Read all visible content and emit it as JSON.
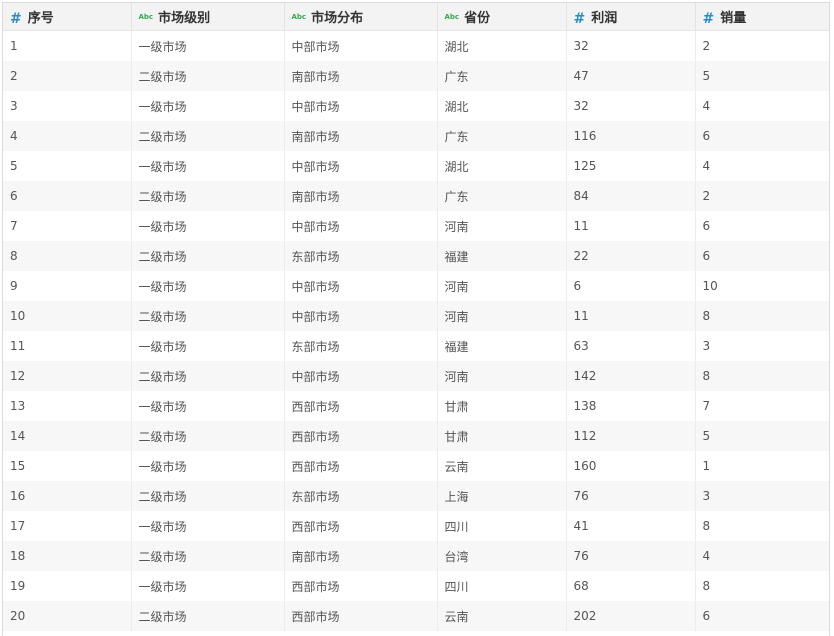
{
  "columns": [
    {
      "label": "序号",
      "type_icon": "#",
      "icon_name": "numeric-type-icon"
    },
    {
      "label": "市场级别",
      "type_icon": "Abc",
      "icon_name": "text-type-icon"
    },
    {
      "label": "市场分布",
      "type_icon": "Abc",
      "icon_name": "text-type-icon"
    },
    {
      "label": "省份",
      "type_icon": "Abc",
      "icon_name": "text-type-icon"
    },
    {
      "label": "利润",
      "type_icon": "#",
      "icon_name": "numeric-type-icon"
    },
    {
      "label": "销量",
      "type_icon": "#",
      "icon_name": "numeric-type-icon"
    }
  ],
  "rows": [
    [
      "1",
      "一级市场",
      "中部市场",
      "湖北",
      "32",
      "2"
    ],
    [
      "2",
      "二级市场",
      "南部市场",
      "广东",
      "47",
      "5"
    ],
    [
      "3",
      "一级市场",
      "中部市场",
      "湖北",
      "32",
      "4"
    ],
    [
      "4",
      "二级市场",
      "南部市场",
      "广东",
      "116",
      "6"
    ],
    [
      "5",
      "一级市场",
      "中部市场",
      "湖北",
      "125",
      "4"
    ],
    [
      "6",
      "二级市场",
      "南部市场",
      "广东",
      "84",
      "2"
    ],
    [
      "7",
      "一级市场",
      "中部市场",
      "河南",
      "11",
      "6"
    ],
    [
      "8",
      "二级市场",
      "东部市场",
      "福建",
      "22",
      "6"
    ],
    [
      "9",
      "一级市场",
      "中部市场",
      "河南",
      "6",
      "10"
    ],
    [
      "10",
      "二级市场",
      "中部市场",
      "河南",
      "11",
      "8"
    ],
    [
      "11",
      "一级市场",
      "东部市场",
      "福建",
      "63",
      "3"
    ],
    [
      "12",
      "二级市场",
      "中部市场",
      "河南",
      "142",
      "8"
    ],
    [
      "13",
      "一级市场",
      "西部市场",
      "甘肃",
      "138",
      "7"
    ],
    [
      "14",
      "二级市场",
      "西部市场",
      "甘肃",
      "112",
      "5"
    ],
    [
      "15",
      "一级市场",
      "西部市场",
      "云南",
      "160",
      "1"
    ],
    [
      "16",
      "二级市场",
      "东部市场",
      "上海",
      "76",
      "3"
    ],
    [
      "17",
      "一级市场",
      "西部市场",
      "四川",
      "41",
      "8"
    ],
    [
      "18",
      "二级市场",
      "南部市场",
      "台湾",
      "76",
      "4"
    ],
    [
      "19",
      "一级市场",
      "西部市场",
      "四川",
      "68",
      "8"
    ],
    [
      "20",
      "二级市场",
      "西部市场",
      "云南",
      "202",
      "6"
    ]
  ],
  "colors": {
    "numeric_icon": "#2e8bc0",
    "text_icon": "#34a853",
    "header_bg": "#f3f3f3",
    "stripe_bg": "#f7f7f7"
  }
}
